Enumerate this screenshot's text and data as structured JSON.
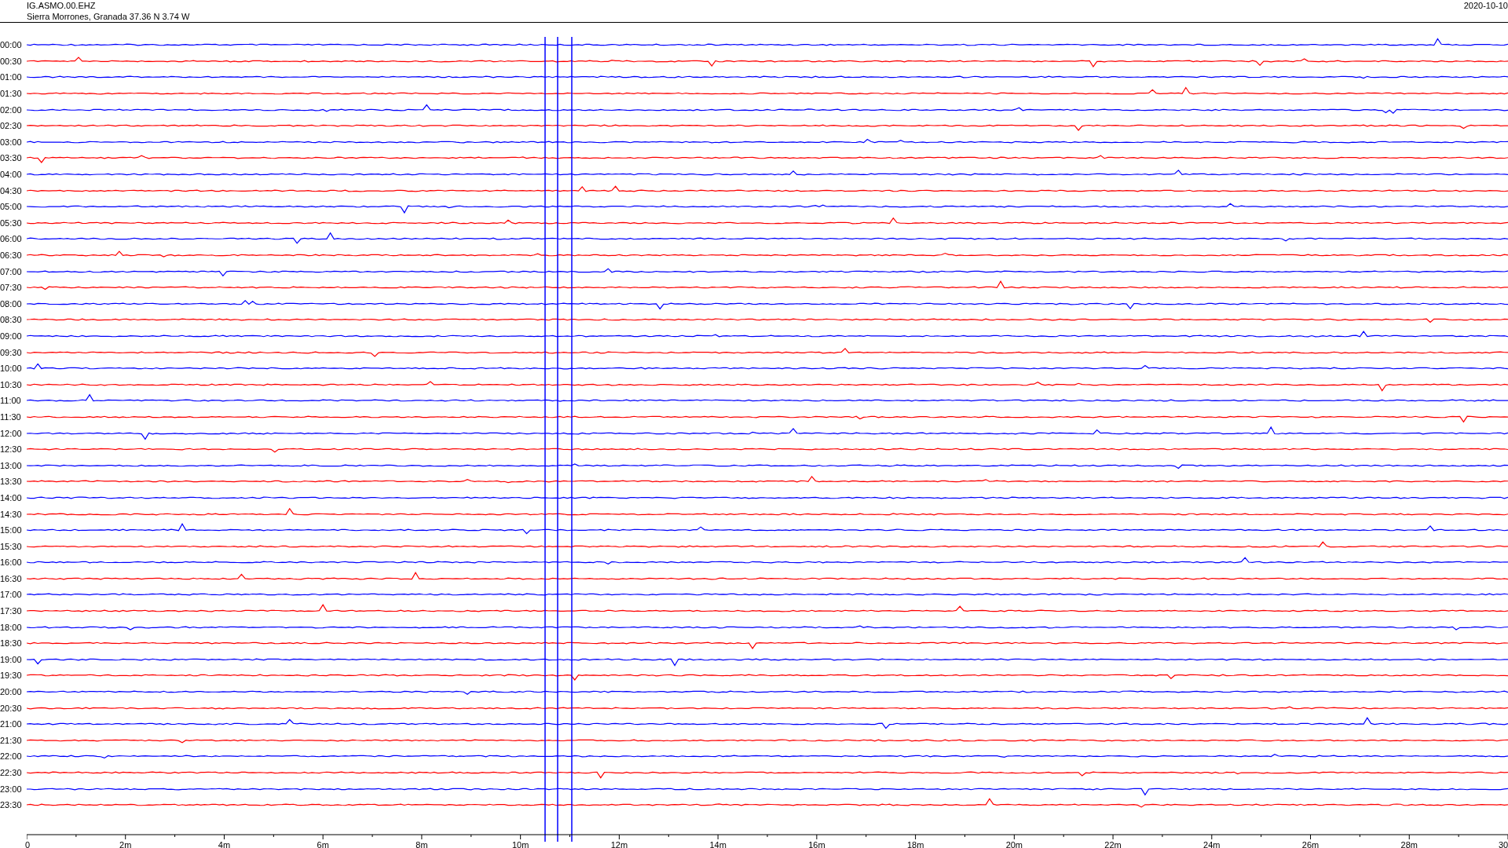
{
  "header": {
    "station": "IG.ASMO.00.EHZ",
    "location": "Sierra Morrones, Granada  37.36 N 3.74 W",
    "date": "2020-10-10"
  },
  "rows": [
    {
      "label": "00:00",
      "color": "#0000ff"
    },
    {
      "label": "00:30",
      "color": "#ff0000"
    },
    {
      "label": "01:00",
      "color": "#0000ff"
    },
    {
      "label": "01:30",
      "color": "#ff0000"
    },
    {
      "label": "02:00",
      "color": "#0000ff"
    },
    {
      "label": "02:30",
      "color": "#ff0000"
    },
    {
      "label": "03:00",
      "color": "#0000ff"
    },
    {
      "label": "03:30",
      "color": "#ff0000"
    },
    {
      "label": "04:00",
      "color": "#0000ff"
    },
    {
      "label": "04:30",
      "color": "#ff0000"
    },
    {
      "label": "05:00",
      "color": "#0000ff"
    },
    {
      "label": "05:30",
      "color": "#ff0000"
    },
    {
      "label": "06:00",
      "color": "#0000ff"
    },
    {
      "label": "06:30",
      "color": "#ff0000"
    },
    {
      "label": "07:00",
      "color": "#0000ff"
    },
    {
      "label": "07:30",
      "color": "#ff0000"
    },
    {
      "label": "08:00",
      "color": "#0000ff"
    },
    {
      "label": "08:30",
      "color": "#ff0000"
    },
    {
      "label": "09:00",
      "color": "#0000ff"
    },
    {
      "label": "09:30",
      "color": "#ff0000"
    },
    {
      "label": "10:00",
      "color": "#0000ff"
    },
    {
      "label": "10:30",
      "color": "#ff0000"
    },
    {
      "label": "11:00",
      "color": "#0000ff"
    },
    {
      "label": "11:30",
      "color": "#ff0000"
    },
    {
      "label": "12:00",
      "color": "#0000ff"
    },
    {
      "label": "12:30",
      "color": "#ff0000"
    },
    {
      "label": "13:00",
      "color": "#0000ff"
    },
    {
      "label": "13:30",
      "color": "#ff0000"
    },
    {
      "label": "14:00",
      "color": "#0000ff"
    },
    {
      "label": "14:30",
      "color": "#ff0000"
    },
    {
      "label": "15:00",
      "color": "#0000ff"
    },
    {
      "label": "15:30",
      "color": "#ff0000"
    },
    {
      "label": "16:00",
      "color": "#0000ff"
    },
    {
      "label": "16:30",
      "color": "#ff0000"
    },
    {
      "label": "17:00",
      "color": "#0000ff"
    },
    {
      "label": "17:30",
      "color": "#ff0000"
    },
    {
      "label": "18:00",
      "color": "#0000ff"
    },
    {
      "label": "18:30",
      "color": "#ff0000"
    },
    {
      "label": "19:00",
      "color": "#0000ff"
    },
    {
      "label": "19:30",
      "color": "#ff0000"
    },
    {
      "label": "20:00",
      "color": "#0000ff"
    },
    {
      "label": "20:30",
      "color": "#ff0000"
    },
    {
      "label": "21:00",
      "color": "#0000ff"
    },
    {
      "label": "21:30",
      "color": "#ff0000"
    },
    {
      "label": "22:00",
      "color": "#0000ff"
    },
    {
      "label": "22:30",
      "color": "#ff0000"
    },
    {
      "label": "23:00",
      "color": "#0000ff"
    },
    {
      "label": "23:30",
      "color": "#ff0000"
    }
  ],
  "x_axis": {
    "tick_labels": [
      "0",
      "2m",
      "4m",
      "6m",
      "8m",
      "10m",
      "12m",
      "14m",
      "16m",
      "18m",
      "20m",
      "22m",
      "24m",
      "26m",
      "28m",
      "30"
    ]
  }
}
